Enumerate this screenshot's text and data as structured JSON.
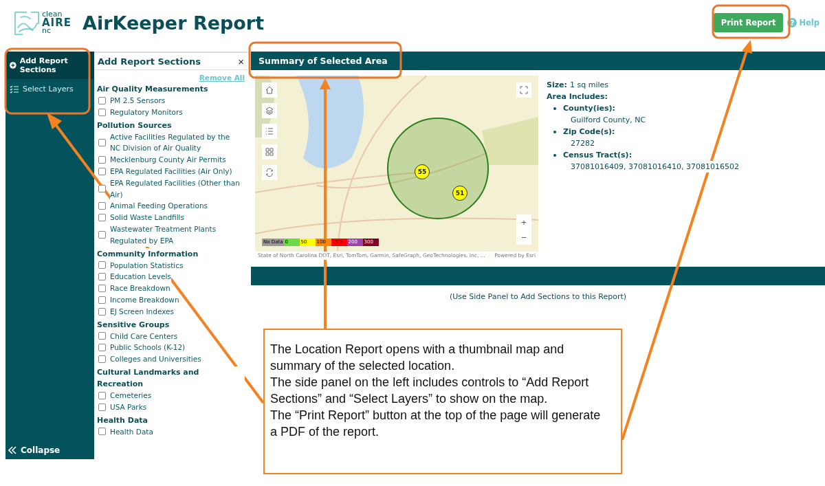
{
  "header": {
    "logo": {
      "line1": "clean",
      "line2": "AIRE",
      "line3": "nc"
    },
    "title": "AirKeeper Report",
    "print_button": "Print Report",
    "help": "Help",
    "help_icon": "?"
  },
  "sidebar": {
    "items": [
      {
        "label": "Add Report Sections",
        "kind": "add",
        "selected": true
      },
      {
        "label": "Select Layers",
        "kind": "layers",
        "selected": false
      }
    ],
    "collapse": "Collapse"
  },
  "panel": {
    "title": "Add Report Sections",
    "close": "×",
    "remove_all": "Remove All",
    "groups": [
      {
        "title": "Air Quality Measurements",
        "items": [
          {
            "label": "PM 2.5 Sensors",
            "checked": false
          },
          {
            "label": "Regulatory Monitors",
            "checked": false
          }
        ]
      },
      {
        "title": "Pollution Sources",
        "items": [
          {
            "label": "Active Facilities Regulated by the NC Division of Air Quality",
            "checked": false
          },
          {
            "label": "Mecklenburg County Air Permits",
            "checked": false
          },
          {
            "label": "EPA Regulated Facilities (Air Only)",
            "checked": false
          },
          {
            "label": "EPA Regulated Facilities (Other than Air)",
            "checked": false
          },
          {
            "label": "Animal Feeding Operations",
            "checked": false
          },
          {
            "label": "Solid Waste Landfills",
            "checked": false
          },
          {
            "label": "Wastewater Treatment Plants Regulated by EPA",
            "checked": false
          }
        ]
      },
      {
        "title": "Community Information",
        "items": [
          {
            "label": "Population Statistics",
            "checked": false
          },
          {
            "label": "Education Levels",
            "checked": false
          },
          {
            "label": "Race Breakdown",
            "checked": false
          },
          {
            "label": "Income Breakdown",
            "checked": false
          },
          {
            "label": "EJ Screen Indexes",
            "checked": false
          }
        ]
      },
      {
        "title": "Sensitive Groups",
        "items": [
          {
            "label": "Child Care Centers",
            "checked": false
          },
          {
            "label": "Public Schools (K-12)",
            "checked": false
          },
          {
            "label": "Colleges and Universities",
            "checked": false
          }
        ]
      },
      {
        "title": "Cultural Landmarks and Recreation",
        "items": [
          {
            "label": "Cemeteries",
            "checked": false
          },
          {
            "label": "USA Parks",
            "checked": false
          }
        ]
      },
      {
        "title": "Health Data",
        "items": [
          {
            "label": "Health Data",
            "checked": false
          }
        ]
      }
    ]
  },
  "summary": {
    "title": "Summary of Selected Area",
    "map": {
      "legend": [
        {
          "label": "No Data",
          "color": "#9a9a9a"
        },
        {
          "label": "0",
          "color": "#66dd44"
        },
        {
          "label": "50",
          "color": "#ffff00"
        },
        {
          "label": "100",
          "color": "#ff8800"
        },
        {
          "label": "150",
          "color": "#ff0000"
        },
        {
          "label": "200",
          "color": "#9944aa"
        },
        {
          "label": "300",
          "color": "#7e0023"
        }
      ],
      "markers": [
        {
          "label": "55"
        },
        {
          "label": "51"
        }
      ],
      "zoom_in": "+",
      "zoom_out": "−",
      "attribution": "State of North Carolina DOT, Esri, TomTom, Garmin, SafeGraph, GeoTechnologies, Inc, ...",
      "powered_by": "Powered by Esri"
    },
    "size_label": "Size:",
    "size_value": "1 sq miles",
    "area_label": "Area Includes:",
    "area_items": [
      {
        "label": "County(ies):",
        "value": "Guilford County, NC"
      },
      {
        "label": "Zip Code(s):",
        "value": "27282"
      },
      {
        "label": "Census Tract(s):",
        "value": "37081016409, 37081016410, 37081016502"
      }
    ],
    "note": "(Use Side Panel to Add Sections to this Report)"
  },
  "callout": {
    "paragraphs": [
      "The Location Report opens with a thumbnail map and summary of the selected location.",
      "The side panel on the left includes controls to “Add Report Sections” and “Select Layers” to show on the map.",
      "The “Print Report” button at the top of the page will generate a PDF of the report."
    ]
  }
}
